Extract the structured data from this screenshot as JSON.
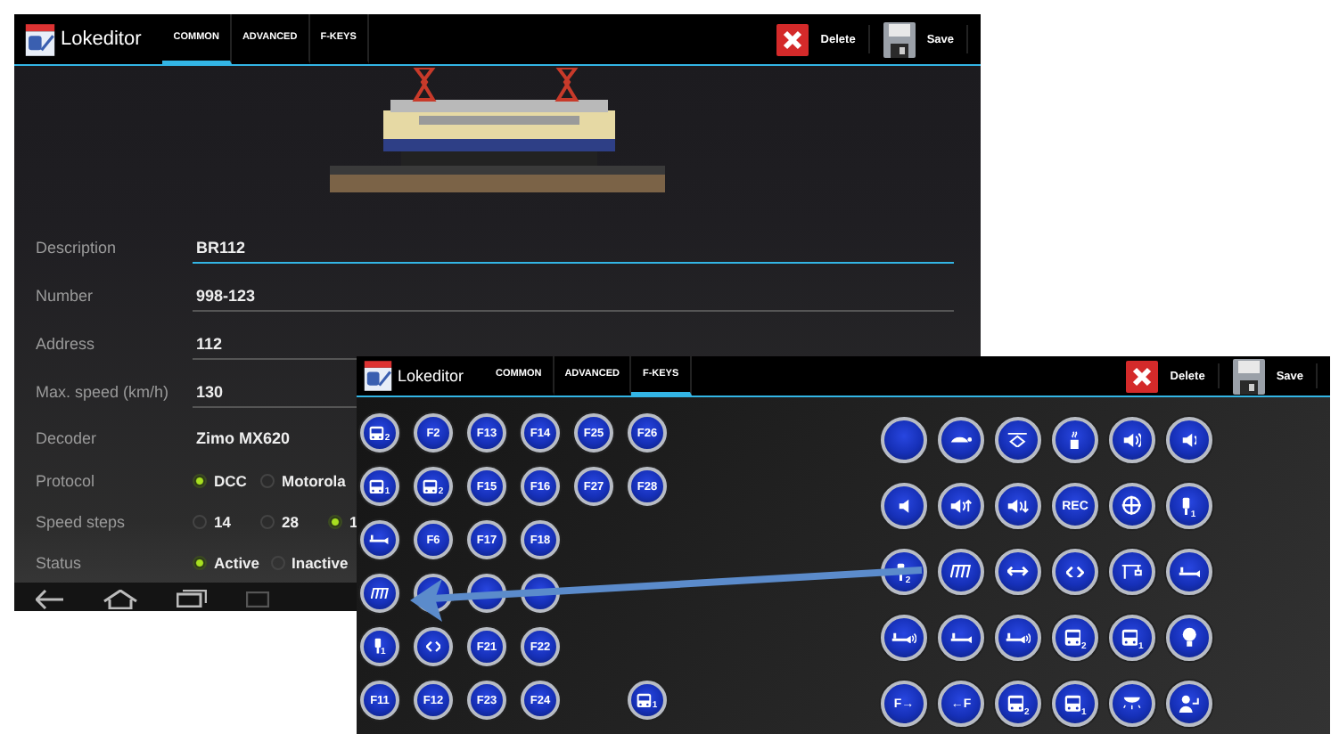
{
  "editor": {
    "title": "Lokeditor",
    "tabs": [
      {
        "label": "COMMON",
        "selected": true
      },
      {
        "label": "ADVANCED",
        "selected": false
      },
      {
        "label": "F-KEYS",
        "selected": false
      }
    ],
    "actions": [
      {
        "kind": "delete",
        "label": "Delete"
      },
      {
        "kind": "save",
        "label": "Save"
      }
    ],
    "fields": [
      {
        "kind": "input",
        "label": "Description",
        "value": "BR112",
        "focused": true
      },
      {
        "kind": "input",
        "label": "Number",
        "value": "998-123",
        "focused": false
      },
      {
        "kind": "input",
        "label": "Address",
        "value": "112",
        "focused": false
      },
      {
        "kind": "input",
        "label": "Max. speed (km/h)",
        "value": "130",
        "focused": false
      },
      {
        "kind": "static",
        "label": "Decoder",
        "value": "Zimo MX620"
      },
      {
        "kind": "radio",
        "label": "Protocol",
        "options": [
          {
            "label": "DCC",
            "selected": true
          },
          {
            "label": "Motorola",
            "selected": false
          }
        ]
      },
      {
        "kind": "radio",
        "label": "Speed steps",
        "options": [
          {
            "label": "14",
            "selected": false
          },
          {
            "label": "28",
            "selected": false
          },
          {
            "label": "1",
            "selected": true
          }
        ]
      },
      {
        "kind": "radio",
        "label": "Status",
        "options": [
          {
            "label": "Active",
            "selected": true
          },
          {
            "label": "Inactive",
            "selected": false
          }
        ]
      }
    ]
  },
  "fkeys": {
    "title": "Lokeditor",
    "tabs": [
      {
        "label": "COMMON",
        "selected": false
      },
      {
        "label": "ADVANCED",
        "selected": false
      },
      {
        "label": "F-KEYS",
        "selected": true
      }
    ],
    "actions": [
      {
        "kind": "delete",
        "label": "Delete"
      },
      {
        "kind": "save",
        "label": "Save"
      }
    ],
    "left_keys": [
      [
        {
          "kind": "bus",
          "sub": "2"
        },
        {
          "kind": "label",
          "label": "F2"
        },
        {
          "kind": "label",
          "label": "F13"
        },
        {
          "kind": "label",
          "label": "F14"
        },
        {
          "kind": "label",
          "label": "F25"
        },
        {
          "kind": "label",
          "label": "F26"
        }
      ],
      [
        {
          "kind": "bus",
          "sub": "1"
        },
        {
          "kind": "bus",
          "sub": "2"
        },
        {
          "kind": "label",
          "label": "F15"
        },
        {
          "kind": "label",
          "label": "F16"
        },
        {
          "kind": "label",
          "label": "F27"
        },
        {
          "kind": "label",
          "label": "F28"
        }
      ],
      [
        {
          "kind": "horn"
        },
        {
          "kind": "label",
          "label": "F6"
        },
        {
          "kind": "label",
          "label": "F17"
        },
        {
          "kind": "label",
          "label": "F18"
        }
      ],
      [
        {
          "kind": "music"
        },
        {
          "kind": "covered"
        },
        {
          "kind": "covered"
        },
        {
          "kind": "covered"
        }
      ],
      [
        {
          "kind": "lamp",
          "sub": "1"
        },
        {
          "kind": "coupler"
        },
        {
          "kind": "label",
          "label": "F21"
        },
        {
          "kind": "label",
          "label": "F22"
        }
      ],
      [
        {
          "kind": "label",
          "label": "F11"
        },
        {
          "kind": "label",
          "label": "F12"
        },
        {
          "kind": "label",
          "label": "F23"
        },
        {
          "kind": "label",
          "label": "F24"
        },
        {
          "kind": "gap"
        },
        {
          "kind": "bus",
          "sub": "1"
        }
      ]
    ],
    "right_keys": [
      [
        {
          "kind": "plain"
        },
        {
          "kind": "turtle"
        },
        {
          "kind": "sign"
        },
        {
          "kind": "smoke"
        },
        {
          "kind": "sound-high"
        },
        {
          "kind": "sound-mid"
        }
      ],
      [
        {
          "kind": "sound-low"
        },
        {
          "kind": "sound-up"
        },
        {
          "kind": "sound-down"
        },
        {
          "kind": "label",
          "label": "REC"
        },
        {
          "kind": "wheel"
        },
        {
          "kind": "lamp",
          "sub": "1"
        }
      ],
      [
        {
          "kind": "lamp",
          "sub": "2"
        },
        {
          "kind": "music"
        },
        {
          "kind": "arrows"
        },
        {
          "kind": "coupler"
        },
        {
          "kind": "crane"
        },
        {
          "kind": "horn"
        }
      ],
      [
        {
          "kind": "horn-sound"
        },
        {
          "kind": "horn"
        },
        {
          "kind": "horn-sound"
        },
        {
          "kind": "bus",
          "sub": "2"
        },
        {
          "kind": "bus",
          "sub": "1"
        },
        {
          "kind": "bulb"
        }
      ],
      [
        {
          "kind": "label",
          "label": "F→"
        },
        {
          "kind": "label",
          "label": "←F"
        },
        {
          "kind": "bus",
          "sub": "2"
        },
        {
          "kind": "bus",
          "sub": "1"
        },
        {
          "kind": "dome"
        },
        {
          "kind": "person"
        }
      ]
    ]
  }
}
